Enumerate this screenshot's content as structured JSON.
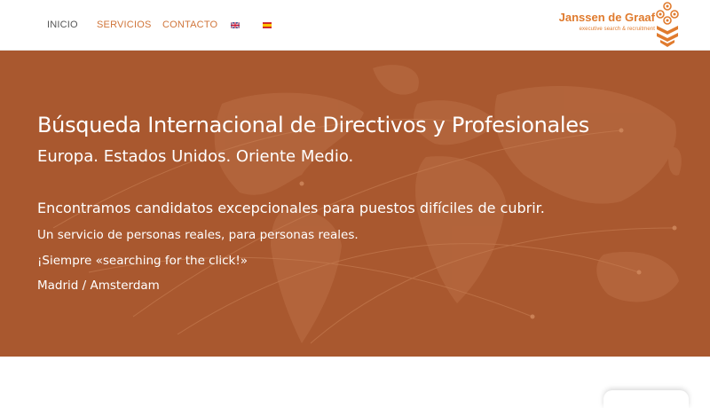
{
  "nav": {
    "items": [
      {
        "label": "INICIO",
        "color": "#555555"
      },
      {
        "label": "SERVICIOS",
        "color": "#d0753a"
      },
      {
        "label": "CONTACTO",
        "color": "#d0753a"
      }
    ],
    "languages": [
      "english-flag-icon",
      "spanish-flag-icon"
    ]
  },
  "logo": {
    "name": "Janssen de Graaf",
    "tagline": "executive search & recruitment",
    "color": "#e07b2e"
  },
  "hero": {
    "background": "#a9582f",
    "title": "Búsqueda Internacional de Directivos y Profesionales",
    "subtitle": "Europa. Estados Unidos. Oriente Medio.",
    "lead": "Encontramos candidatos excepcionales para puestos difíciles de cubrir.",
    "line1": "Un servicio de personas reales, para personas reales.",
    "line2": "¡Siempre «searching for the click!»",
    "line3": "Madrid / Amsterdam"
  }
}
